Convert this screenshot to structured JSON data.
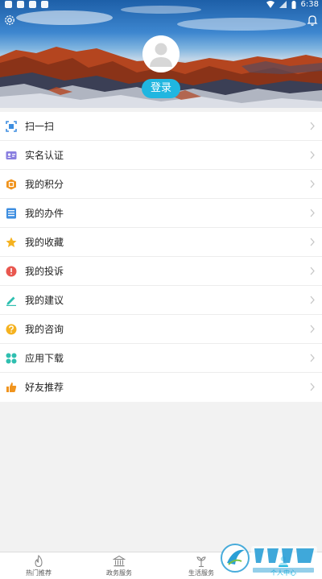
{
  "status_bar": {
    "time": "6:38"
  },
  "header": {
    "login_label": "登录"
  },
  "menu": {
    "items": [
      {
        "label": "扫一扫",
        "icon": "scan-icon"
      },
      {
        "label": "实名认证",
        "icon": "id-card-icon"
      },
      {
        "label": "我的积分",
        "icon": "points-icon"
      },
      {
        "label": "我的办件",
        "icon": "document-icon"
      },
      {
        "label": "我的收藏",
        "icon": "star-icon"
      },
      {
        "label": "我的投诉",
        "icon": "alert-icon"
      },
      {
        "label": "我的建议",
        "icon": "pencil-icon"
      },
      {
        "label": "我的咨询",
        "icon": "question-icon"
      },
      {
        "label": "应用下载",
        "icon": "apps-icon"
      },
      {
        "label": "好友推荐",
        "icon": "thumbs-up-icon"
      }
    ]
  },
  "bottom_nav": {
    "items": [
      {
        "label": "热门推荐",
        "icon": "flame-icon"
      },
      {
        "label": "政务服务",
        "icon": "government-icon"
      },
      {
        "label": "生活服务",
        "icon": "plant-icon"
      },
      {
        "label": "",
        "icon": ""
      },
      {
        "label": "个人中心",
        "icon": "person-icon"
      }
    ]
  },
  "watermark": {
    "text": "飞翔下载",
    "url": "www.fxxz.com"
  },
  "colors": {
    "accent": "#20b6e0",
    "scan": "#3e8ee0",
    "idcard": "#8a7fe0",
    "points": "#f0941e",
    "document": "#3e8ee0",
    "star": "#f5b21f",
    "alert": "#e9574f",
    "pencil": "#2fbfb0",
    "question": "#f5b21f",
    "apps": "#2fbfb0",
    "thumbs": "#f0941e"
  }
}
